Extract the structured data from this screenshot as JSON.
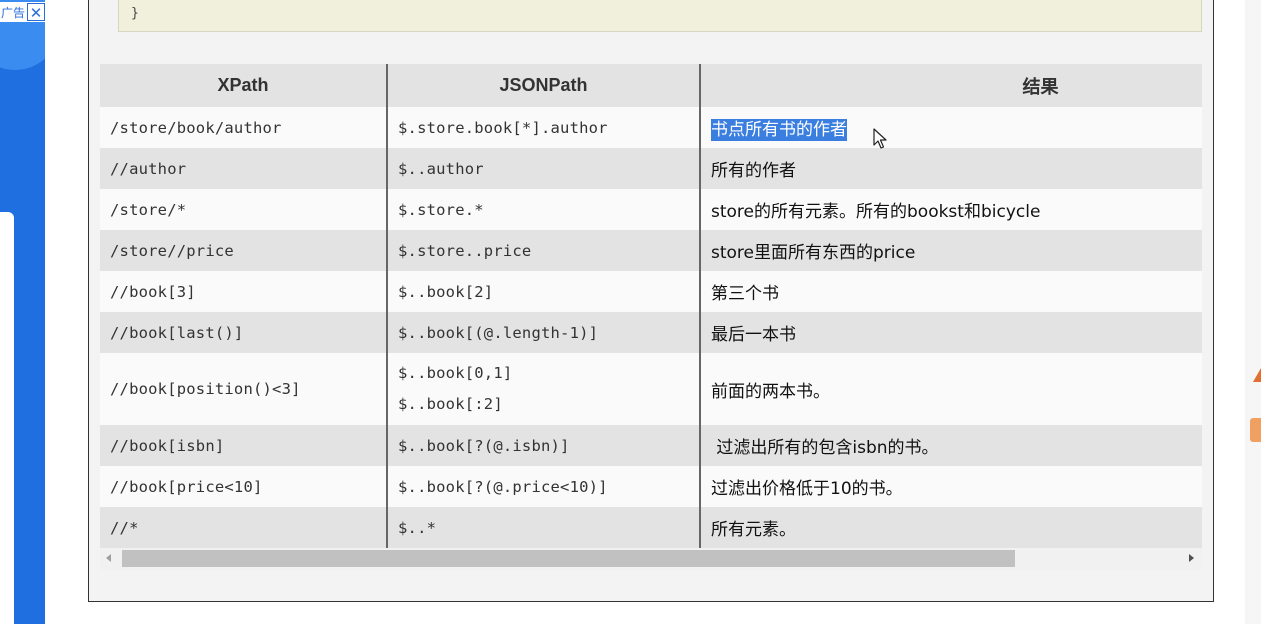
{
  "ad": {
    "label": "广告",
    "close": "✕"
  },
  "code": {
    "closing_brace": "}"
  },
  "table": {
    "headers": [
      "XPath",
      "JSONPath",
      "结果"
    ],
    "rows": [
      {
        "xpath": "/store/book/author",
        "jsonpath": [
          "$.store.book[*].author"
        ],
        "result": "书点所有书的作者",
        "highlighted": true
      },
      {
        "xpath": "//author",
        "jsonpath": [
          "$..author"
        ],
        "result": "所有的作者"
      },
      {
        "xpath": "/store/*",
        "jsonpath": [
          "$.store.*"
        ],
        "result": "store的所有元素。所有的bookst和bicycle"
      },
      {
        "xpath": "/store//price",
        "jsonpath": [
          "$.store..price"
        ],
        "result": "store里面所有东西的price"
      },
      {
        "xpath": "//book[3]",
        "jsonpath": [
          "$..book[2]"
        ],
        "result": "第三个书"
      },
      {
        "xpath": "//book[last()]",
        "jsonpath": [
          "$..book[(@.length-1)]"
        ],
        "result": "最后一本书"
      },
      {
        "xpath": "//book[position()<3]",
        "jsonpath": [
          "$..book[0,1]",
          "$..book[:2]"
        ],
        "result": "前面的两本书。"
      },
      {
        "xpath": "//book[isbn]",
        "jsonpath": [
          "$..book[?(@.isbn)]"
        ],
        "result": " 过滤出所有的包含isbn的书。"
      },
      {
        "xpath": "//book[price<10]",
        "jsonpath": [
          "$..book[?(@.price<10)]"
        ],
        "result": "过滤出价格低于10的书。"
      },
      {
        "xpath": "//*",
        "jsonpath": [
          "$..*"
        ],
        "result": "所有元素。"
      }
    ]
  },
  "colors": {
    "highlight": "#3a7ee0",
    "header_bg": "#e3e3e3",
    "ad_blue": "#1f6fe0"
  },
  "icons": {
    "cursor": "mouse-pointer-icon",
    "scroll_left": "scroll-left-arrow-icon",
    "scroll_right": "scroll-right-arrow-icon"
  }
}
